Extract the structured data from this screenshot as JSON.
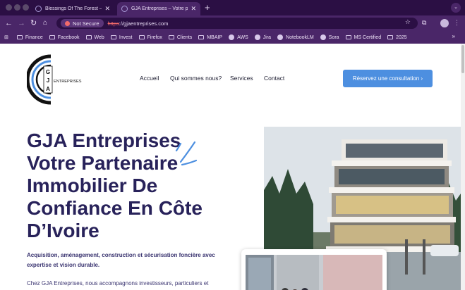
{
  "browser": {
    "tabs": [
      {
        "title": "Blessings Of The Forest – We",
        "active": false
      },
      {
        "title": "GJA Entreprises – Votre parte",
        "active": true
      }
    ],
    "security_label": "Not Secure",
    "url_scheme": "https",
    "url_rest": "://gjaentreprises.com",
    "bookmarks": [
      {
        "label": "Finance",
        "icon": "folder-icon"
      },
      {
        "label": "Facebook",
        "icon": "folder-icon"
      },
      {
        "label": "Web",
        "icon": "folder-icon"
      },
      {
        "label": "Invest",
        "icon": "folder-icon"
      },
      {
        "label": "Firefox",
        "icon": "folder-icon"
      },
      {
        "label": "Clients",
        "icon": "folder-icon"
      },
      {
        "label": "MBAIP",
        "icon": "folder-icon"
      },
      {
        "label": "AWS",
        "icon": "globe-icon"
      },
      {
        "label": "Jira",
        "icon": "globe-icon"
      },
      {
        "label": "NotebookLM",
        "icon": "globe-icon"
      },
      {
        "label": "Sora",
        "icon": "globe-icon"
      },
      {
        "label": "MS Certified",
        "icon": "folder-icon"
      },
      {
        "label": "2025",
        "icon": "folder-icon"
      }
    ],
    "overflow_glyph": "»"
  },
  "site": {
    "logo_letters": [
      "G",
      "J",
      "A"
    ],
    "logo_word": "ENTREPRISES",
    "nav": [
      "Accueil",
      "Qui sommes nous?",
      "Services",
      "Contact"
    ],
    "cta": "Réservez une consultation ›",
    "hero": {
      "title_lines": [
        "GJA Entreprises",
        "Votre Partenaire",
        "Immobilier De",
        "Confiance En Côte",
        "D’Ivoire"
      ],
      "subtitle": "Acquisition, aménagement, construction et sécurisation foncière avec expertise et vision durable.",
      "body": "Chez GJA Entreprises, nous accompagnons investisseurs, particuliers et"
    }
  },
  "colors": {
    "chrome_dark": "#2b0f44",
    "chrome": "#4a2668",
    "title": "#28225a",
    "cta": "#4d8fe0",
    "accent_swoosh": "#4d8fe0"
  }
}
